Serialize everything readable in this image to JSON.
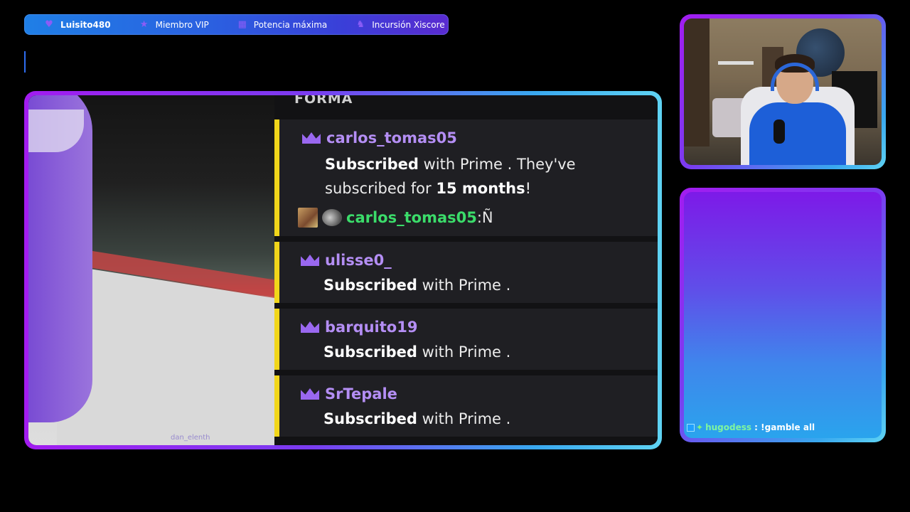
{
  "top_bar": {
    "items": [
      {
        "icon": "heart-icon",
        "label": "Luisito480"
      },
      {
        "icon": "star-icon",
        "label": "Miembro VIP"
      },
      {
        "icon": "gift-icon",
        "label": "Potencia máxima"
      },
      {
        "icon": "raid-icon",
        "label": "Incursión Xiscore"
      }
    ]
  },
  "main": {
    "header_fragment": "FORMA",
    "watermark": "dan_elenth",
    "subs": [
      {
        "user": "carlos_tomas05",
        "msg_bold": "Subscribed",
        "msg_rest": " with Prime . They've",
        "msg2_pre": "subscribed for ",
        "msg2_bold": "15 months",
        "msg2_post": "!"
      },
      {
        "user": "ulisse0_",
        "msg_bold": "Subscribed",
        "msg_rest": " with Prime ."
      },
      {
        "user": "barquito19",
        "msg_bold": "Subscribed",
        "msg_rest": " with Prime ."
      },
      {
        "user": "SrTepale",
        "msg_bold": "Subscribed",
        "msg_rest": " with Prime ."
      }
    ],
    "chat_line": {
      "user": "carlos_tomas05",
      "sep": ": ",
      "text": "Ñ"
    },
    "colors": {
      "accent_purple": "#b48ef4",
      "sub_bar": "#f1d61a",
      "chat_green": "#3bdc6a"
    }
  },
  "chat_overlay": {
    "user": "hugodess",
    "sep": " : ",
    "text": "!gamble all"
  },
  "frame_gradient": [
    "#a21cf0",
    "#7a3cf0",
    "#39a8ef",
    "#5fd3f3"
  ]
}
